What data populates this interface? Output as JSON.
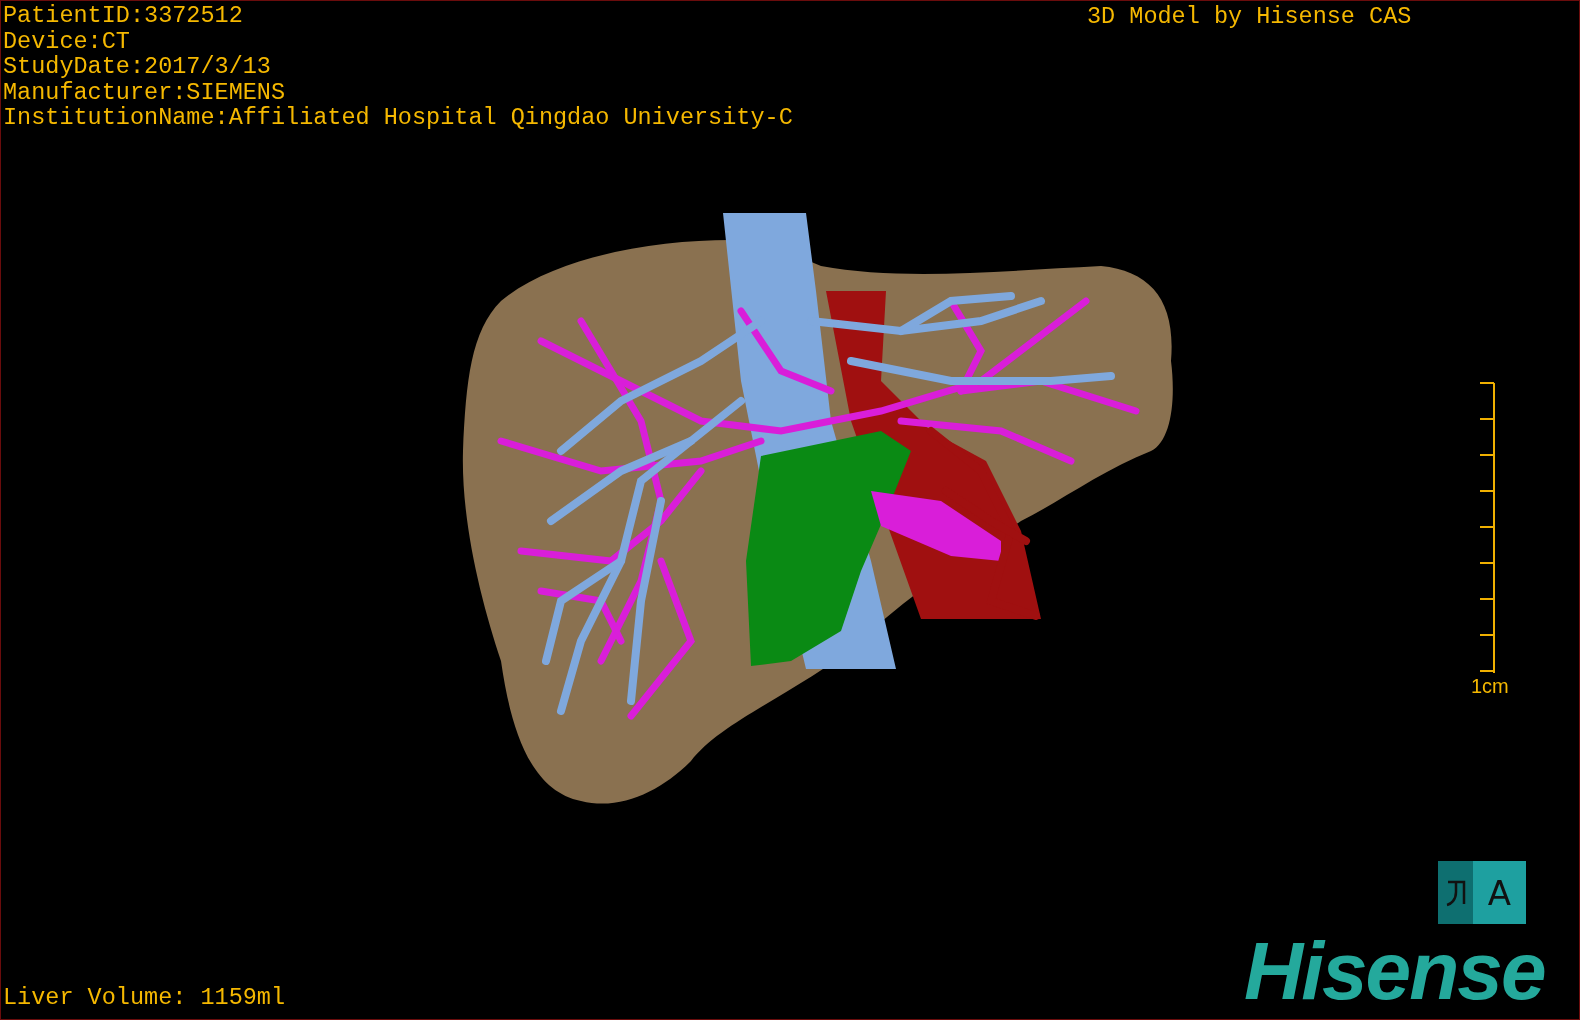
{
  "patient_info": [
    "PatientID:3372512",
    "Device:CT",
    "StudyDate:2017/3/13",
    "Manufacturer:SIEMENS",
    "InstitutionName:Affiliated Hospital Qingdao University-C"
  ],
  "model_caption": "3D Model by Hisense CAS",
  "scale_bar": {
    "label": "1cm"
  },
  "text_button": {
    "label": "A"
  },
  "logo": "Hisense",
  "liver_volume": "Liver Volume: 1159ml"
}
